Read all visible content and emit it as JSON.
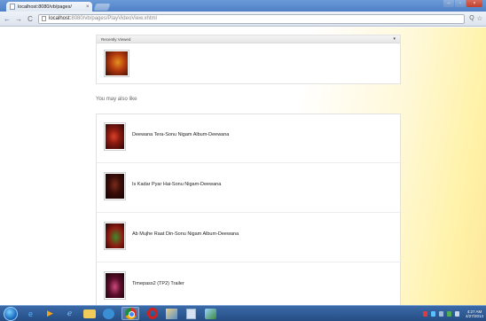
{
  "browser": {
    "tab_title": "localhost:8080/vb/pages/",
    "tab_close": "×",
    "url_host": "localhost:",
    "url_path": "8080/vb/pages/PlayVideoView.xhtml",
    "back_glyph": "←",
    "forward_glyph": "→",
    "reload_glyph": "C",
    "zoom_glyph": "Q",
    "star_glyph": "☆"
  },
  "recently_viewed": {
    "title": "Recently Viewed",
    "caret": "▾"
  },
  "also_like_label": "You may also like",
  "videos": [
    {
      "title": "Deewana Tera-Sonu Nigam Album-Deewana",
      "thumb_icon": "music-video-thumbnail"
    },
    {
      "title": "Is Kadar Pyar Hai-Sonu Nigam-Deewana",
      "thumb_icon": "music-video-thumbnail"
    },
    {
      "title": "Ab Mujhe Raat Din-Sonu Nigam Album-Deewana",
      "thumb_icon": "music-video-thumbnail"
    },
    {
      "title": "Timepass2 (TP2) Trailer",
      "thumb_icon": "music-video-thumbnail"
    }
  ],
  "taskbar": {
    "clock_time": "4:27 AM",
    "clock_date": "4/27/2014"
  }
}
